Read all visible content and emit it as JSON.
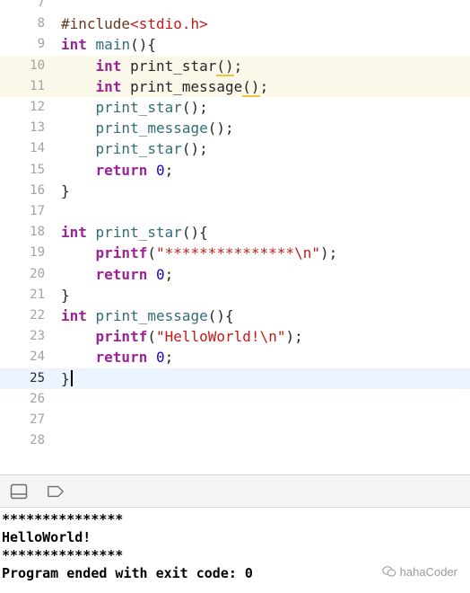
{
  "editor": {
    "lines": [
      {
        "num": "7",
        "tokens": []
      },
      {
        "num": "8",
        "tokens": [
          {
            "t": "#include",
            "c": "pp"
          },
          {
            "t": "<stdio.h>",
            "c": "str"
          }
        ]
      },
      {
        "num": "9",
        "tokens": [
          {
            "t": "int",
            "c": "kw"
          },
          {
            "t": " ",
            "c": "plain"
          },
          {
            "t": "main",
            "c": "fn"
          },
          {
            "t": "(){",
            "c": "plain"
          }
        ]
      },
      {
        "num": "10",
        "highlight": "warning",
        "tokens": [
          {
            "t": "    ",
            "c": "plain"
          },
          {
            "t": "int",
            "c": "kw"
          },
          {
            "t": " print_star",
            "c": "plain"
          },
          {
            "t": "()",
            "c": "plain",
            "warn": true
          },
          {
            "t": ";",
            "c": "plain"
          }
        ]
      },
      {
        "num": "11",
        "highlight": "warning",
        "tokens": [
          {
            "t": "    ",
            "c": "plain"
          },
          {
            "t": "int",
            "c": "kw"
          },
          {
            "t": " print_message",
            "c": "plain"
          },
          {
            "t": "()",
            "c": "plain",
            "warn": true
          },
          {
            "t": ";",
            "c": "plain"
          }
        ]
      },
      {
        "num": "12",
        "tokens": [
          {
            "t": "    ",
            "c": "plain"
          },
          {
            "t": "print_star",
            "c": "fn"
          },
          {
            "t": "();",
            "c": "plain"
          }
        ]
      },
      {
        "num": "13",
        "tokens": [
          {
            "t": "    ",
            "c": "plain"
          },
          {
            "t": "print_message",
            "c": "fn"
          },
          {
            "t": "();",
            "c": "plain"
          }
        ]
      },
      {
        "num": "14",
        "tokens": [
          {
            "t": "    ",
            "c": "plain"
          },
          {
            "t": "print_star",
            "c": "fn"
          },
          {
            "t": "();",
            "c": "plain"
          }
        ]
      },
      {
        "num": "15",
        "tokens": [
          {
            "t": "    ",
            "c": "plain"
          },
          {
            "t": "return",
            "c": "kw"
          },
          {
            "t": " ",
            "c": "plain"
          },
          {
            "t": "0",
            "c": "num"
          },
          {
            "t": ";",
            "c": "plain"
          }
        ]
      },
      {
        "num": "16",
        "tokens": [
          {
            "t": "}",
            "c": "plain"
          }
        ]
      },
      {
        "num": "17",
        "tokens": []
      },
      {
        "num": "18",
        "tokens": [
          {
            "t": "int",
            "c": "kw"
          },
          {
            "t": " ",
            "c": "plain"
          },
          {
            "t": "print_star",
            "c": "fn"
          },
          {
            "t": "(){",
            "c": "plain"
          }
        ]
      },
      {
        "num": "19",
        "tokens": [
          {
            "t": "    ",
            "c": "plain"
          },
          {
            "t": "printf",
            "c": "kw"
          },
          {
            "t": "(",
            "c": "plain"
          },
          {
            "t": "\"***************\\n\"",
            "c": "str"
          },
          {
            "t": ");",
            "c": "plain"
          }
        ]
      },
      {
        "num": "20",
        "tokens": [
          {
            "t": "    ",
            "c": "plain"
          },
          {
            "t": "return",
            "c": "kw"
          },
          {
            "t": " ",
            "c": "plain"
          },
          {
            "t": "0",
            "c": "num"
          },
          {
            "t": ";",
            "c": "plain"
          }
        ]
      },
      {
        "num": "21",
        "tokens": [
          {
            "t": "}",
            "c": "plain"
          }
        ]
      },
      {
        "num": "22",
        "tokens": [
          {
            "t": "int",
            "c": "kw"
          },
          {
            "t": " ",
            "c": "plain"
          },
          {
            "t": "print_message",
            "c": "fn"
          },
          {
            "t": "(){",
            "c": "plain"
          }
        ]
      },
      {
        "num": "23",
        "tokens": [
          {
            "t": "    ",
            "c": "plain"
          },
          {
            "t": "printf",
            "c": "kw"
          },
          {
            "t": "(",
            "c": "plain"
          },
          {
            "t": "\"HelloWorld!\\n\"",
            "c": "str"
          },
          {
            "t": ");",
            "c": "plain"
          }
        ]
      },
      {
        "num": "24",
        "tokens": [
          {
            "t": "    ",
            "c": "plain"
          },
          {
            "t": "return",
            "c": "kw"
          },
          {
            "t": " ",
            "c": "plain"
          },
          {
            "t": "0",
            "c": "num"
          },
          {
            "t": ";",
            "c": "plain"
          }
        ]
      },
      {
        "num": "25",
        "highlight": "current",
        "caret": true,
        "tokens": [
          {
            "t": "}",
            "c": "plain"
          }
        ]
      },
      {
        "num": "26",
        "tokens": []
      },
      {
        "num": "27",
        "tokens": []
      },
      {
        "num": "28",
        "tokens": []
      }
    ]
  },
  "toolbar": {
    "icons": [
      "hide-debug-area-icon",
      "breakpoint-icon"
    ]
  },
  "console": {
    "output": [
      "***************",
      "HelloWorld!",
      "***************",
      "Program ended with exit code: 0"
    ]
  },
  "watermark": {
    "text": "hahaCoder"
  },
  "colors": {
    "keyword": "#9b2393",
    "preprocessor": "#643820",
    "string": "#c41a16",
    "number": "#1c00cf",
    "function": "#326d74",
    "warning_line": "#fbf8ea",
    "current_line": "#ecf5ff"
  }
}
